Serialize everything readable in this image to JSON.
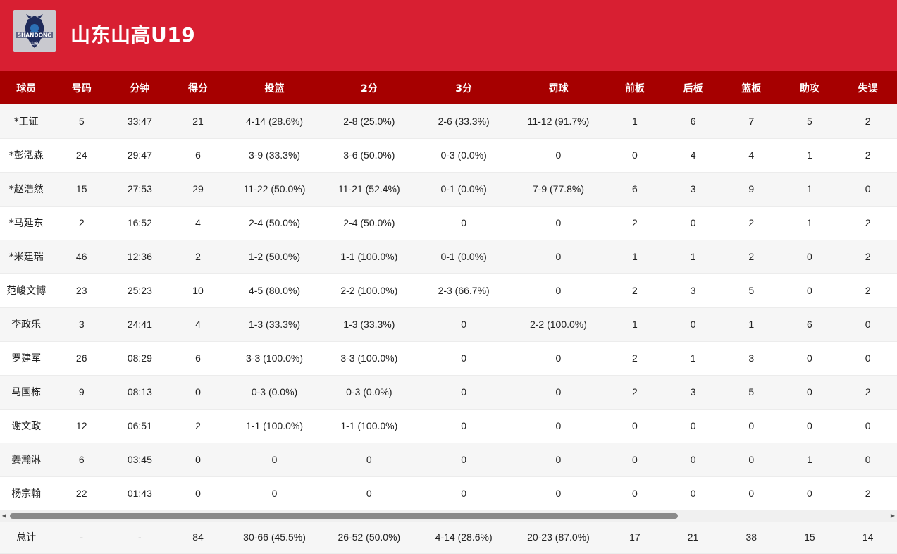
{
  "team": {
    "name": "山东山高U19",
    "logo_text": "SHANDONG",
    "logo_subtext": "山高"
  },
  "columns": [
    "球员",
    "号码",
    "分钟",
    "得分",
    "投篮",
    "2分",
    "3分",
    "罚球",
    "前板",
    "后板",
    "篮板",
    "助攻",
    "失误"
  ],
  "rows": [
    [
      "*王证",
      "5",
      "33:47",
      "21",
      "4-14 (28.6%)",
      "2-8 (25.0%)",
      "2-6 (33.3%)",
      "11-12 (91.7%)",
      "1",
      "6",
      "7",
      "5",
      "2"
    ],
    [
      "*彭泓森",
      "24",
      "29:47",
      "6",
      "3-9 (33.3%)",
      "3-6 (50.0%)",
      "0-3 (0.0%)",
      "0",
      "0",
      "4",
      "4",
      "1",
      "2"
    ],
    [
      "*赵浩然",
      "15",
      "27:53",
      "29",
      "11-22 (50.0%)",
      "11-21 (52.4%)",
      "0-1 (0.0%)",
      "7-9 (77.8%)",
      "6",
      "3",
      "9",
      "1",
      "0"
    ],
    [
      "*马延东",
      "2",
      "16:52",
      "4",
      "2-4 (50.0%)",
      "2-4 (50.0%)",
      "0",
      "0",
      "2",
      "0",
      "2",
      "1",
      "2"
    ],
    [
      "*米建瑞",
      "46",
      "12:36",
      "2",
      "1-2 (50.0%)",
      "1-1 (100.0%)",
      "0-1 (0.0%)",
      "0",
      "1",
      "1",
      "2",
      "0",
      "2"
    ],
    [
      "范峻文博",
      "23",
      "25:23",
      "10",
      "4-5 (80.0%)",
      "2-2 (100.0%)",
      "2-3 (66.7%)",
      "0",
      "2",
      "3",
      "5",
      "0",
      "2"
    ],
    [
      "李政乐",
      "3",
      "24:41",
      "4",
      "1-3 (33.3%)",
      "1-3 (33.3%)",
      "0",
      "2-2 (100.0%)",
      "1",
      "0",
      "1",
      "6",
      "0"
    ],
    [
      "罗建军",
      "26",
      "08:29",
      "6",
      "3-3 (100.0%)",
      "3-3 (100.0%)",
      "0",
      "0",
      "2",
      "1",
      "3",
      "0",
      "0"
    ],
    [
      "马国栋",
      "9",
      "08:13",
      "0",
      "0-3 (0.0%)",
      "0-3 (0.0%)",
      "0",
      "0",
      "2",
      "3",
      "5",
      "0",
      "2"
    ],
    [
      "谢文政",
      "12",
      "06:51",
      "2",
      "1-1 (100.0%)",
      "1-1 (100.0%)",
      "0",
      "0",
      "0",
      "0",
      "0",
      "0",
      "0"
    ],
    [
      "姜瀚淋",
      "6",
      "03:45",
      "0",
      "0",
      "0",
      "0",
      "0",
      "0",
      "0",
      "0",
      "1",
      "0"
    ],
    [
      "杨宗翰",
      "22",
      "01:43",
      "0",
      "0",
      "0",
      "0",
      "0",
      "0",
      "0",
      "0",
      "0",
      "2"
    ]
  ],
  "totals": [
    "总计",
    "-",
    "-",
    "84",
    "30-66 (45.5%)",
    "26-52 (50.0%)",
    "4-14 (28.6%)",
    "20-23 (87.0%)",
    "17",
    "21",
    "38",
    "15",
    "14"
  ],
  "colors": {
    "header_bg": "#d81f32",
    "table_header_bg": "#a60000"
  }
}
